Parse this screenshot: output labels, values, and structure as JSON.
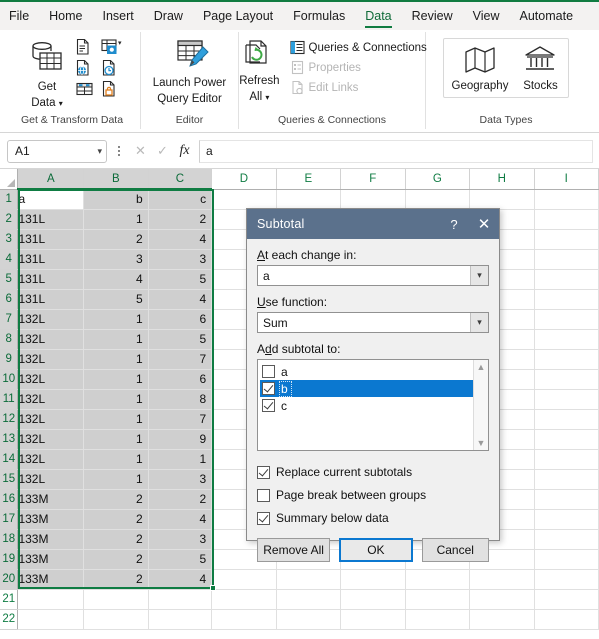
{
  "ribbon": {
    "tabs": [
      {
        "label": "File",
        "active": false
      },
      {
        "label": "Home",
        "active": false
      },
      {
        "label": "Insert",
        "active": false
      },
      {
        "label": "Draw",
        "active": false
      },
      {
        "label": "Page Layout",
        "active": false
      },
      {
        "label": "Formulas",
        "active": false
      },
      {
        "label": "Data",
        "active": true
      },
      {
        "label": "Review",
        "active": false
      },
      {
        "label": "View",
        "active": false
      },
      {
        "label": "Automate",
        "active": false
      }
    ],
    "groups": {
      "get_transform": {
        "label": "Get & Transform Data",
        "get_data_label": "Get\nData",
        "get_data_line1": "Get",
        "get_data_line2": "Data",
        "small_buttons": [
          {
            "name": "from-text-csv-icon"
          },
          {
            "name": "from-web-table-icon"
          },
          {
            "name": "from-web-icon"
          },
          {
            "name": "recent-sources-icon"
          },
          {
            "name": "from-table-range-icon"
          },
          {
            "name": "existing-connections-icon"
          }
        ]
      },
      "editor": {
        "label": "Editor",
        "launch_line1": "Launch Power",
        "launch_line2": "Query Editor"
      },
      "queries": {
        "label": "Queries & Connections",
        "refresh_line1": "Refresh",
        "refresh_line2": "All",
        "items": [
          {
            "label": "Queries & Connections",
            "disabled": false
          },
          {
            "label": "Properties",
            "disabled": true
          },
          {
            "label": "Edit Links",
            "disabled": true
          }
        ]
      },
      "data_types": {
        "label": "Data Types",
        "items": [
          {
            "label": "Geography"
          },
          {
            "label": "Stocks"
          }
        ]
      }
    }
  },
  "formula_bar": {
    "name_box": "A1",
    "formula_value": "a",
    "cancel_icon": "✕",
    "confirm_icon": "✓",
    "fx_label": "fx"
  },
  "grid": {
    "columns": [
      "A",
      "B",
      "C",
      "D",
      "E",
      "F",
      "G",
      "H",
      "I"
    ],
    "selected_columns": [
      "A",
      "B",
      "C"
    ],
    "row_count": 22,
    "selected_rows": [
      1,
      2,
      3,
      4,
      5,
      6,
      7,
      8,
      9,
      10,
      11,
      12,
      13,
      14,
      15,
      16,
      17,
      18,
      19,
      20
    ],
    "active_cell": "A1",
    "rows": [
      {
        "n": 1,
        "a": "a",
        "b": "b",
        "c": "c"
      },
      {
        "n": 2,
        "a": "131L",
        "b": "1",
        "c": "2"
      },
      {
        "n": 3,
        "a": "131L",
        "b": "2",
        "c": "4"
      },
      {
        "n": 4,
        "a": "131L",
        "b": "3",
        "c": "3"
      },
      {
        "n": 5,
        "a": "131L",
        "b": "4",
        "c": "5"
      },
      {
        "n": 6,
        "a": "131L",
        "b": "5",
        "c": "4"
      },
      {
        "n": 7,
        "a": "132L",
        "b": "1",
        "c": "6"
      },
      {
        "n": 8,
        "a": "132L",
        "b": "1",
        "c": "5"
      },
      {
        "n": 9,
        "a": "132L",
        "b": "1",
        "c": "7"
      },
      {
        "n": 10,
        "a": "132L",
        "b": "1",
        "c": "6"
      },
      {
        "n": 11,
        "a": "132L",
        "b": "1",
        "c": "8"
      },
      {
        "n": 12,
        "a": "132L",
        "b": "1",
        "c": "7"
      },
      {
        "n": 13,
        "a": "132L",
        "b": "1",
        "c": "9"
      },
      {
        "n": 14,
        "a": "132L",
        "b": "1",
        "c": "1"
      },
      {
        "n": 15,
        "a": "132L",
        "b": "1",
        "c": "3"
      },
      {
        "n": 16,
        "a": "133M",
        "b": "2",
        "c": "2"
      },
      {
        "n": 17,
        "a": "133M",
        "b": "2",
        "c": "4"
      },
      {
        "n": 18,
        "a": "133M",
        "b": "2",
        "c": "3"
      },
      {
        "n": 19,
        "a": "133M",
        "b": "2",
        "c": "5"
      },
      {
        "n": 20,
        "a": "133M",
        "b": "2",
        "c": "4"
      },
      {
        "n": 21,
        "a": "",
        "b": "",
        "c": ""
      },
      {
        "n": 22,
        "a": "",
        "b": "",
        "c": ""
      }
    ]
  },
  "dialog": {
    "title": "Subtotal",
    "help_icon": "?",
    "close_icon": "✕",
    "at_each_change_label": "At each change in:",
    "at_each_change_value": "a",
    "use_function_label": "Use function:",
    "use_function_value": "Sum",
    "add_subtotal_label": "Add subtotal to:",
    "subtotal_fields": [
      {
        "label": "a",
        "checked": false,
        "selected": false
      },
      {
        "label": "b",
        "checked": true,
        "selected": true
      },
      {
        "label": "c",
        "checked": true,
        "selected": false
      }
    ],
    "options": [
      {
        "label": "Replace current subtotals",
        "checked": true
      },
      {
        "label": "Page break between groups",
        "checked": false
      },
      {
        "label": "Summary below data",
        "checked": true
      }
    ],
    "buttons": {
      "remove_all": "Remove All",
      "ok": "OK",
      "cancel": "Cancel"
    },
    "colors": {
      "titlebar": "#5b718c",
      "selection": "#0b78d0",
      "focus_border": "#0b78d0"
    }
  },
  "colors": {
    "excel_green": "#107c41",
    "selection_green": "#0f7c43",
    "shaded_cell": "#cfcfcf"
  }
}
